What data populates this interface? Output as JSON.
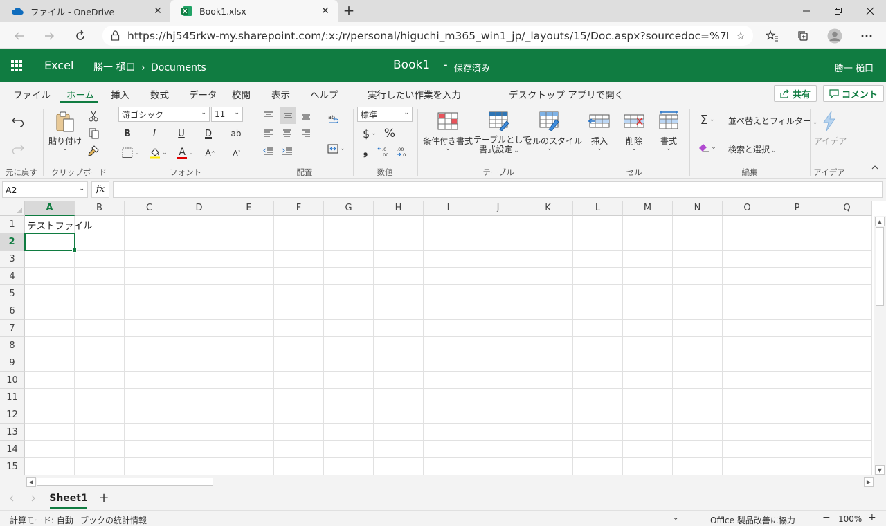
{
  "browser": {
    "tabs": [
      {
        "label": "ファイル - OneDrive",
        "close": "✕"
      },
      {
        "label": "Book1.xlsx",
        "close": "✕"
      }
    ],
    "new_tab": "+",
    "url": "https://hj545rkw-my.sharepoint.com/:x:/r/personal/higuchi_m365_win1_jp/_layouts/15/Doc.aspx?sourcedoc=%7BBD4B3...",
    "icons": [
      "onedrive-cloud-icon",
      "excel-file-icon",
      "back-arrow-icon",
      "forward-arrow-icon",
      "refresh-icon",
      "lock-icon",
      "favorite-star-icon",
      "favorites-list-icon",
      "collections-icon",
      "profile-avatar-icon",
      "more-options-icon"
    ]
  },
  "app": {
    "name": "Excel",
    "breadcrumb_user": "勝一 樋口",
    "breadcrumb_sep": "›",
    "breadcrumb_folder": "Documents",
    "doc_title": "Book1",
    "title_sep": "-",
    "save_state": "保存済み",
    "user_name": "勝一 樋口",
    "brand_color": "#107c41"
  },
  "ribbon_tabs": [
    "ファイル",
    "ホーム",
    "挿入",
    "数式",
    "データ",
    "校閲",
    "表示",
    "ヘルプ",
    "実行したい作業を入力",
    "デスクトップ アプリで開く"
  ],
  "share_label": "共有",
  "comment_label": "コメント",
  "ribbon": {
    "undo_group": "元に戻す",
    "clipboard": {
      "paste": "貼り付け",
      "group": "クリップボード"
    },
    "font": {
      "name": "游ゴシック",
      "size": "11",
      "bold": "B",
      "italic": "I",
      "underline": "U",
      "double_underline": "D",
      "strike": "ab",
      "grow": "A",
      "shrink": "A",
      "font_color": "A",
      "group": "フォント"
    },
    "alignment": {
      "group": "配置"
    },
    "number": {
      "format": "標準",
      "currency": "$",
      "percent": "%",
      "comma": "❟",
      "inc_decimal": "←.0 .00",
      "dec_decimal": ".00 →.0",
      "group": "数値"
    },
    "table": {
      "conditional": "条件付き書式",
      "as_table_1": "テーブルとして",
      "as_table_2": "書式設定",
      "cell_styles": "セルのスタイル",
      "group": "テーブル"
    },
    "cells": {
      "insert": "挿入",
      "delete": "削除",
      "format": "書式",
      "group": "セル"
    },
    "editing": {
      "sum": "Σ",
      "sort": "並べ替えとフィルター",
      "find": "検索と選択",
      "group": "編集"
    },
    "ideas": {
      "label": "アイデア",
      "group": "アイデア"
    }
  },
  "formula_bar": {
    "name_box": "A2",
    "fx": "fx",
    "value": ""
  },
  "grid": {
    "columns": [
      "A",
      "B",
      "C",
      "D",
      "E",
      "F",
      "G",
      "H",
      "I",
      "J",
      "K",
      "L",
      "M",
      "N",
      "O",
      "P",
      "Q"
    ],
    "rows": [
      "1",
      "2",
      "3",
      "4",
      "5",
      "6",
      "7",
      "8",
      "9",
      "10",
      "11",
      "12",
      "13",
      "14",
      "15"
    ],
    "active_column": "A",
    "active_row": "2",
    "cells": {
      "A1": "テストファイル"
    }
  },
  "sheets": {
    "tabs": [
      "Sheet1"
    ],
    "add": "+"
  },
  "status": {
    "calc_mode": "計算モード: 自動",
    "workbook_stats": "ブックの統計情報",
    "feedback": "Office 製品改善に協力",
    "zoom_minus": "−",
    "zoom": "100%",
    "zoom_plus": "+"
  }
}
